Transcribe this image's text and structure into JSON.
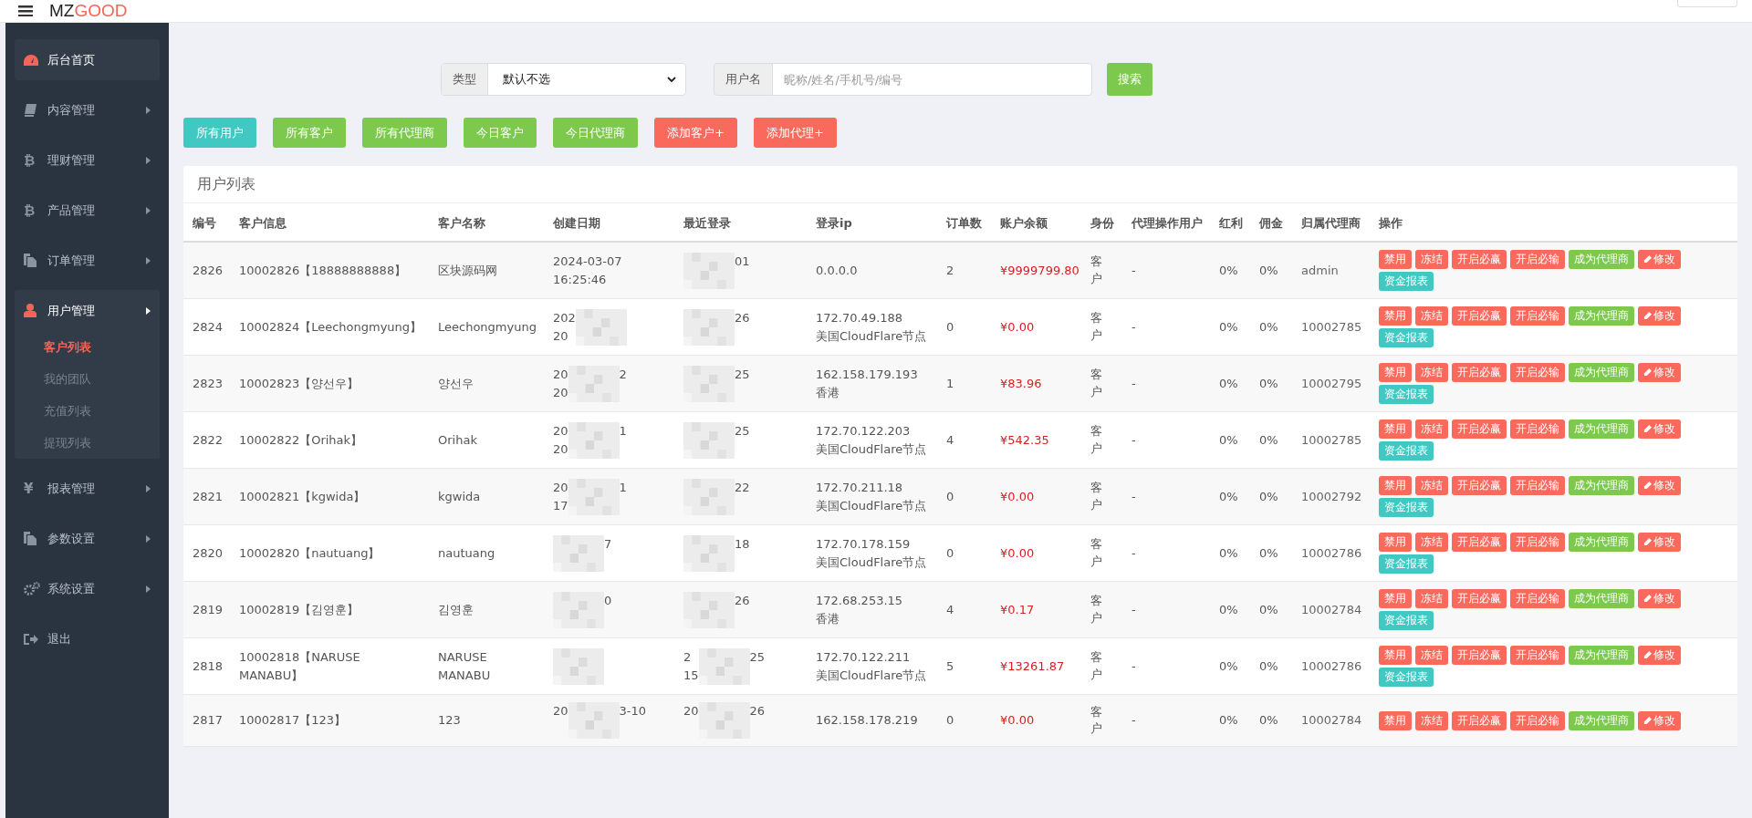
{
  "header": {
    "logo_dark": "MZ",
    "logo_accent": "GOOD"
  },
  "sidebar": {
    "items": [
      {
        "label": "后台首页",
        "active": true
      },
      {
        "label": "内容管理",
        "active": false,
        "expanded": false
      },
      {
        "label": "理财管理",
        "glyph": "₿",
        "active": false,
        "expanded": false
      },
      {
        "label": "产品管理",
        "glyph": "₿",
        "active": false,
        "expanded": false
      },
      {
        "label": "订单管理",
        "active": false,
        "expanded": false
      },
      {
        "label": "用户管理",
        "active": true,
        "expanded": true,
        "children": [
          {
            "label": "客户列表",
            "selected": true
          },
          {
            "label": "我的团队",
            "selected": false
          },
          {
            "label": "充值列表",
            "selected": false
          },
          {
            "label": "提现列表",
            "selected": false
          }
        ]
      },
      {
        "label": "报表管理",
        "glyph": "¥",
        "active": false,
        "expanded": false
      },
      {
        "label": "参数设置",
        "active": false,
        "expanded": false
      },
      {
        "label": "系统设置",
        "active": false,
        "expanded": false
      },
      {
        "label": "退出",
        "active": false
      }
    ]
  },
  "search": {
    "type_label": "类型",
    "type_value": "默认不选",
    "user_label": "用户名",
    "user_placeholder": "昵称/姓名/手机号/编号",
    "button": "搜索"
  },
  "filters": [
    {
      "label": "所有用户",
      "kind": "info"
    },
    {
      "label": "所有客户",
      "kind": "success"
    },
    {
      "label": "所有代理商",
      "kind": "success"
    },
    {
      "label": "今日客户",
      "kind": "success"
    },
    {
      "label": "今日代理商",
      "kind": "success"
    },
    {
      "label": "添加客户+",
      "kind": "danger"
    },
    {
      "label": "添加代理+",
      "kind": "danger"
    }
  ],
  "table": {
    "title": "用户列表",
    "columns": [
      "编号",
      "客户信息",
      "客户名称",
      "创建日期",
      "最近登录",
      "登录ip",
      "订单数",
      "账户余额",
      "身份",
      "代理操作用户",
      "红利",
      "佣金",
      "归属代理商",
      "操作"
    ],
    "rows": [
      {
        "id": "2826",
        "info": "10002826【18888888888】",
        "name": "区块源码网",
        "created": {
          "before": [
            "2024-03-07",
            "16:25:46"
          ],
          "blurred": false
        },
        "login": {
          "after": [
            "01"
          ],
          "blurred": true
        },
        "ip": [
          "0.0.0.0"
        ],
        "orders": "2",
        "balance": "¥9999799.80",
        "role": "客户",
        "agent_op": "-",
        "bonus": "0%",
        "commission": "0%",
        "agent": "admin",
        "actions": [
          {
            "label": "禁用",
            "kind": "danger"
          },
          {
            "label": "冻结",
            "kind": "danger"
          },
          {
            "label": "开启必赢",
            "kind": "danger"
          },
          {
            "label": "开启必输",
            "kind": "danger"
          },
          {
            "label": "成为代理商",
            "kind": "success"
          },
          {
            "label": "修改",
            "kind": "edit"
          },
          {
            "label": "资金报表",
            "kind": "info"
          }
        ]
      },
      {
        "id": "2824",
        "info": "10002824【Leechongmyung】",
        "name": "Leechongmyung",
        "created": {
          "before": [
            "202",
            "20"
          ],
          "blurred": true
        },
        "login": {
          "after": [
            "26"
          ],
          "blurred": true
        },
        "ip": [
          "172.70.49.188",
          "美国CloudFlare节点"
        ],
        "orders": "0",
        "balance": "¥0.00",
        "role": "客户",
        "agent_op": "-",
        "bonus": "0%",
        "commission": "0%",
        "agent": "10002785",
        "actions": [
          {
            "label": "禁用",
            "kind": "danger"
          },
          {
            "label": "冻结",
            "kind": "danger"
          },
          {
            "label": "开启必赢",
            "kind": "danger"
          },
          {
            "label": "开启必输",
            "kind": "danger"
          },
          {
            "label": "成为代理商",
            "kind": "success"
          },
          {
            "label": "修改",
            "kind": "edit"
          },
          {
            "label": "资金报表",
            "kind": "info"
          }
        ]
      },
      {
        "id": "2823",
        "info": "10002823【양선우】",
        "name": "양선우",
        "created": {
          "before": [
            "20",
            "20"
          ],
          "after": [
            "2"
          ],
          "blurred": true
        },
        "login": {
          "after": [
            "25"
          ],
          "blurred": true
        },
        "ip": [
          "162.158.179.193",
          "香港"
        ],
        "orders": "1",
        "balance": "¥83.96",
        "role": "客户",
        "agent_op": "-",
        "bonus": "0%",
        "commission": "0%",
        "agent": "10002795",
        "actions": [
          {
            "label": "禁用",
            "kind": "danger"
          },
          {
            "label": "冻结",
            "kind": "danger"
          },
          {
            "label": "开启必赢",
            "kind": "danger"
          },
          {
            "label": "开启必输",
            "kind": "danger"
          },
          {
            "label": "成为代理商",
            "kind": "success"
          },
          {
            "label": "修改",
            "kind": "edit"
          },
          {
            "label": "资金报表",
            "kind": "info"
          }
        ]
      },
      {
        "id": "2822",
        "info": "10002822【Orihak】",
        "name": "Orihak",
        "created": {
          "before": [
            "20",
            "20"
          ],
          "after": [
            "1"
          ],
          "blurred": true
        },
        "login": {
          "after": [
            "25"
          ],
          "blurred": true
        },
        "ip": [
          "172.70.122.203",
          "美国CloudFlare节点"
        ],
        "orders": "4",
        "balance": "¥542.35",
        "role": "客户",
        "agent_op": "-",
        "bonus": "0%",
        "commission": "0%",
        "agent": "10002785",
        "actions": [
          {
            "label": "禁用",
            "kind": "danger"
          },
          {
            "label": "冻结",
            "kind": "danger"
          },
          {
            "label": "开启必赢",
            "kind": "danger"
          },
          {
            "label": "开启必输",
            "kind": "danger"
          },
          {
            "label": "成为代理商",
            "kind": "success"
          },
          {
            "label": "修改",
            "kind": "edit"
          },
          {
            "label": "资金报表",
            "kind": "info"
          }
        ]
      },
      {
        "id": "2821",
        "info": "10002821【kgwida】",
        "name": "kgwida",
        "created": {
          "before": [
            "20",
            "17"
          ],
          "after": [
            "1"
          ],
          "blurred": true
        },
        "login": {
          "after": [
            "22"
          ],
          "blurred": true
        },
        "ip": [
          "172.70.211.18",
          "美国CloudFlare节点"
        ],
        "orders": "0",
        "balance": "¥0.00",
        "role": "客户",
        "agent_op": "-",
        "bonus": "0%",
        "commission": "0%",
        "agent": "10002792",
        "actions": [
          {
            "label": "禁用",
            "kind": "danger"
          },
          {
            "label": "冻结",
            "kind": "danger"
          },
          {
            "label": "开启必赢",
            "kind": "danger"
          },
          {
            "label": "开启必输",
            "kind": "danger"
          },
          {
            "label": "成为代理商",
            "kind": "success"
          },
          {
            "label": "修改",
            "kind": "edit"
          },
          {
            "label": "资金报表",
            "kind": "info"
          }
        ]
      },
      {
        "id": "2820",
        "info": "10002820【nautuang】",
        "name": "nautuang",
        "created": {
          "after": [
            "7"
          ],
          "blurred": true
        },
        "login": {
          "after": [
            "18"
          ],
          "blurred": true
        },
        "ip": [
          "172.70.178.159",
          "美国CloudFlare节点"
        ],
        "orders": "0",
        "balance": "¥0.00",
        "role": "客户",
        "agent_op": "-",
        "bonus": "0%",
        "commission": "0%",
        "agent": "10002786",
        "actions": [
          {
            "label": "禁用",
            "kind": "danger"
          },
          {
            "label": "冻结",
            "kind": "danger"
          },
          {
            "label": "开启必赢",
            "kind": "danger"
          },
          {
            "label": "开启必输",
            "kind": "danger"
          },
          {
            "label": "成为代理商",
            "kind": "success"
          },
          {
            "label": "修改",
            "kind": "edit"
          },
          {
            "label": "资金报表",
            "kind": "info"
          }
        ]
      },
      {
        "id": "2819",
        "info": "10002819【김영훈】",
        "name": "김영훈",
        "created": {
          "after": [
            "0"
          ],
          "blurred": true
        },
        "login": {
          "after": [
            "26"
          ],
          "blurred": true
        },
        "ip": [
          "172.68.253.15",
          "香港"
        ],
        "orders": "4",
        "balance": "¥0.17",
        "role": "客户",
        "agent_op": "-",
        "bonus": "0%",
        "commission": "0%",
        "agent": "10002784",
        "actions": [
          {
            "label": "禁用",
            "kind": "danger"
          },
          {
            "label": "冻结",
            "kind": "danger"
          },
          {
            "label": "开启必赢",
            "kind": "danger"
          },
          {
            "label": "开启必输",
            "kind": "danger"
          },
          {
            "label": "成为代理商",
            "kind": "success"
          },
          {
            "label": "修改",
            "kind": "edit"
          },
          {
            "label": "资金报表",
            "kind": "info"
          }
        ]
      },
      {
        "id": "2818",
        "info": "10002818【NARUSE MANABU】",
        "name": "NARUSE MANABU",
        "created": {
          "blurred": true
        },
        "login": {
          "before": [
            "2",
            "15"
          ],
          "after": [
            "25"
          ],
          "blurred": true
        },
        "ip": [
          "172.70.122.211",
          "美国CloudFlare节点"
        ],
        "orders": "5",
        "balance": "¥13261.87",
        "role": "客户",
        "agent_op": "-",
        "bonus": "0%",
        "commission": "0%",
        "agent": "10002786",
        "actions": [
          {
            "label": "禁用",
            "kind": "danger"
          },
          {
            "label": "冻结",
            "kind": "danger"
          },
          {
            "label": "开启必赢",
            "kind": "danger"
          },
          {
            "label": "开启必输",
            "kind": "danger"
          },
          {
            "label": "成为代理商",
            "kind": "success"
          },
          {
            "label": "修改",
            "kind": "edit"
          },
          {
            "label": "资金报表",
            "kind": "info"
          }
        ]
      },
      {
        "id": "2817",
        "info": "10002817【123】",
        "name": "123",
        "created": {
          "before": [
            "20"
          ],
          "after": [
            "3-10"
          ],
          "blurred": true
        },
        "login": {
          "before": [
            "20"
          ],
          "after": [
            "26"
          ],
          "blurred": true
        },
        "ip": [
          "162.158.178.219"
        ],
        "orders": "0",
        "balance": "¥0.00",
        "role": "客户",
        "agent_op": "-",
        "bonus": "0%",
        "commission": "0%",
        "agent": "10002784",
        "actions": [
          {
            "label": "禁用",
            "kind": "danger"
          },
          {
            "label": "冻结",
            "kind": "danger"
          },
          {
            "label": "开启必赢",
            "kind": "danger"
          },
          {
            "label": "开启必输",
            "kind": "danger"
          },
          {
            "label": "成为代理商",
            "kind": "success"
          },
          {
            "label": "修改",
            "kind": "edit"
          }
        ]
      }
    ]
  }
}
